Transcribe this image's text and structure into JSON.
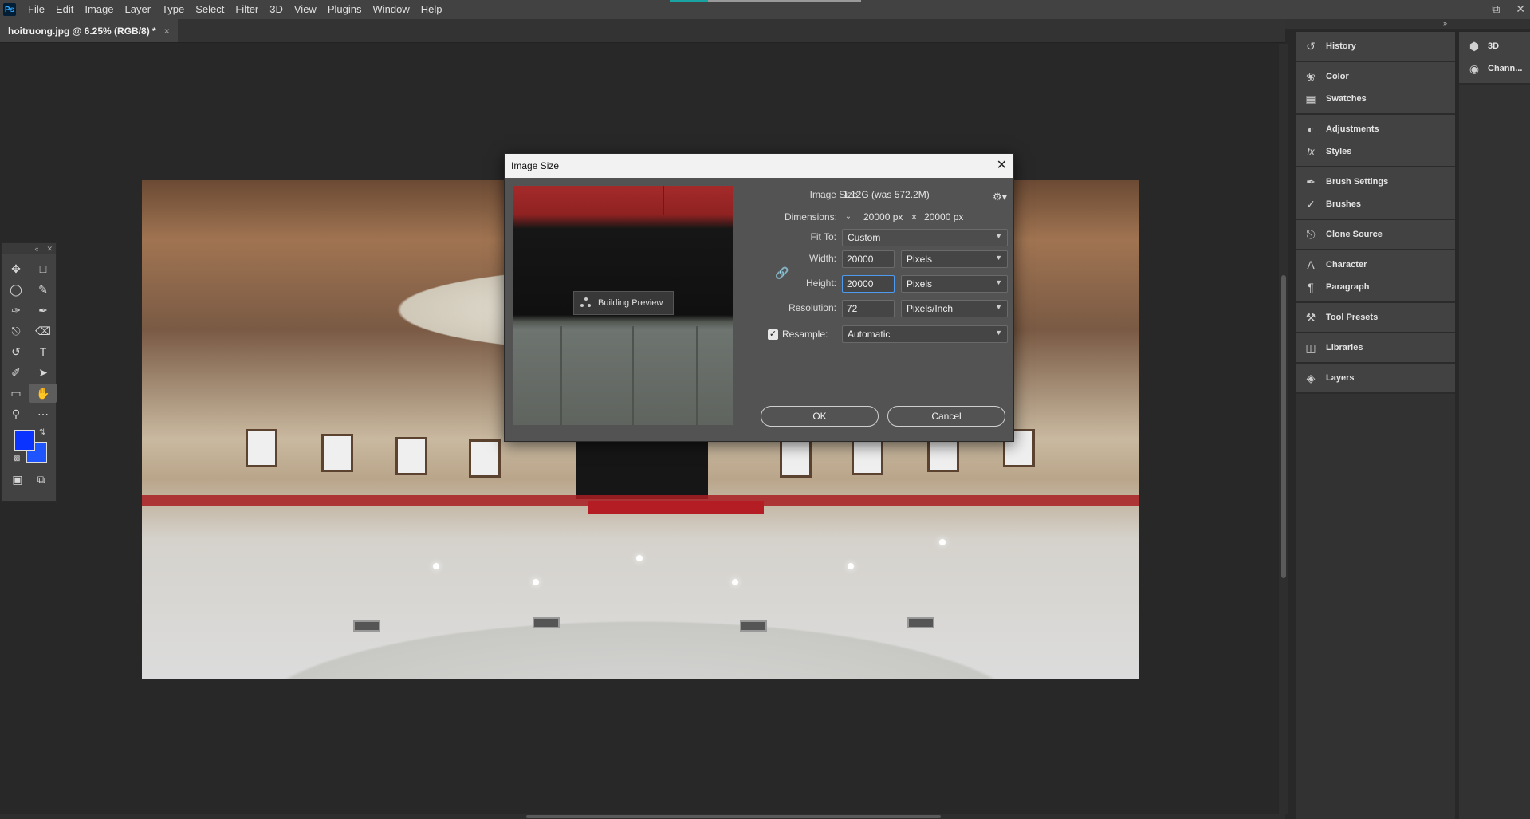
{
  "menubar": {
    "logo": "Ps",
    "items": [
      "File",
      "Edit",
      "Image",
      "Layer",
      "Type",
      "Select",
      "Filter",
      "3D",
      "View",
      "Plugins",
      "Window",
      "Help"
    ]
  },
  "document": {
    "tab_title": "hoitruong.jpg @ 6.25% (RGB/8) *",
    "close_glyph": "×"
  },
  "dialog": {
    "title": "Image Size",
    "preview_status": "Building Preview",
    "image_size_label": "Image Size:",
    "image_size_value": "1.12G (was 572.2M)",
    "dimensions_label": "Dimensions:",
    "dimensions_width": "20000 px",
    "dimensions_x": "×",
    "dimensions_height": "20000 px",
    "fit_to_label": "Fit To:",
    "fit_to_value": "Custom",
    "width_label": "Width:",
    "width_value": "20000",
    "width_unit": "Pixels",
    "height_label": "Height:",
    "height_value": "20000",
    "height_unit": "Pixels",
    "resolution_label": "Resolution:",
    "resolution_value": "72",
    "resolution_unit": "Pixels/Inch",
    "resample_label": "Resample:",
    "resample_checked": true,
    "resample_value": "Automatic",
    "ok_label": "OK",
    "cancel_label": "Cancel"
  },
  "panels": {
    "main": [
      {
        "group": [
          {
            "label": "History",
            "icon": "history-icon"
          }
        ]
      },
      {
        "group": [
          {
            "label": "Color",
            "icon": "color-palette-icon"
          },
          {
            "label": "Swatches",
            "icon": "swatches-grid-icon"
          }
        ]
      },
      {
        "group": [
          {
            "label": "Adjustments",
            "icon": "adjustments-icon"
          },
          {
            "label": "Styles",
            "icon": "fx-icon"
          }
        ]
      },
      {
        "group": [
          {
            "label": "Brush Settings",
            "icon": "brush-settings-icon"
          },
          {
            "label": "Brushes",
            "icon": "brushes-icon"
          }
        ]
      },
      {
        "group": [
          {
            "label": "Clone Source",
            "icon": "clone-source-icon"
          }
        ]
      },
      {
        "group": [
          {
            "label": "Character",
            "icon": "character-icon"
          },
          {
            "label": "Paragraph",
            "icon": "paragraph-icon"
          }
        ]
      },
      {
        "group": [
          {
            "label": "Tool Presets",
            "icon": "tool-presets-icon"
          }
        ]
      },
      {
        "group": [
          {
            "label": "Libraries",
            "icon": "libraries-icon"
          }
        ]
      },
      {
        "group": [
          {
            "label": "Layers",
            "icon": "layers-icon"
          }
        ]
      }
    ],
    "secondary": [
      {
        "label": "3D",
        "icon": "cube-icon"
      },
      {
        "label": "Chann...",
        "icon": "channels-icon"
      }
    ]
  },
  "colors": {
    "foreground": "#0b33ff",
    "background": "#1f55ff",
    "accent_focus": "#4e9af1"
  }
}
